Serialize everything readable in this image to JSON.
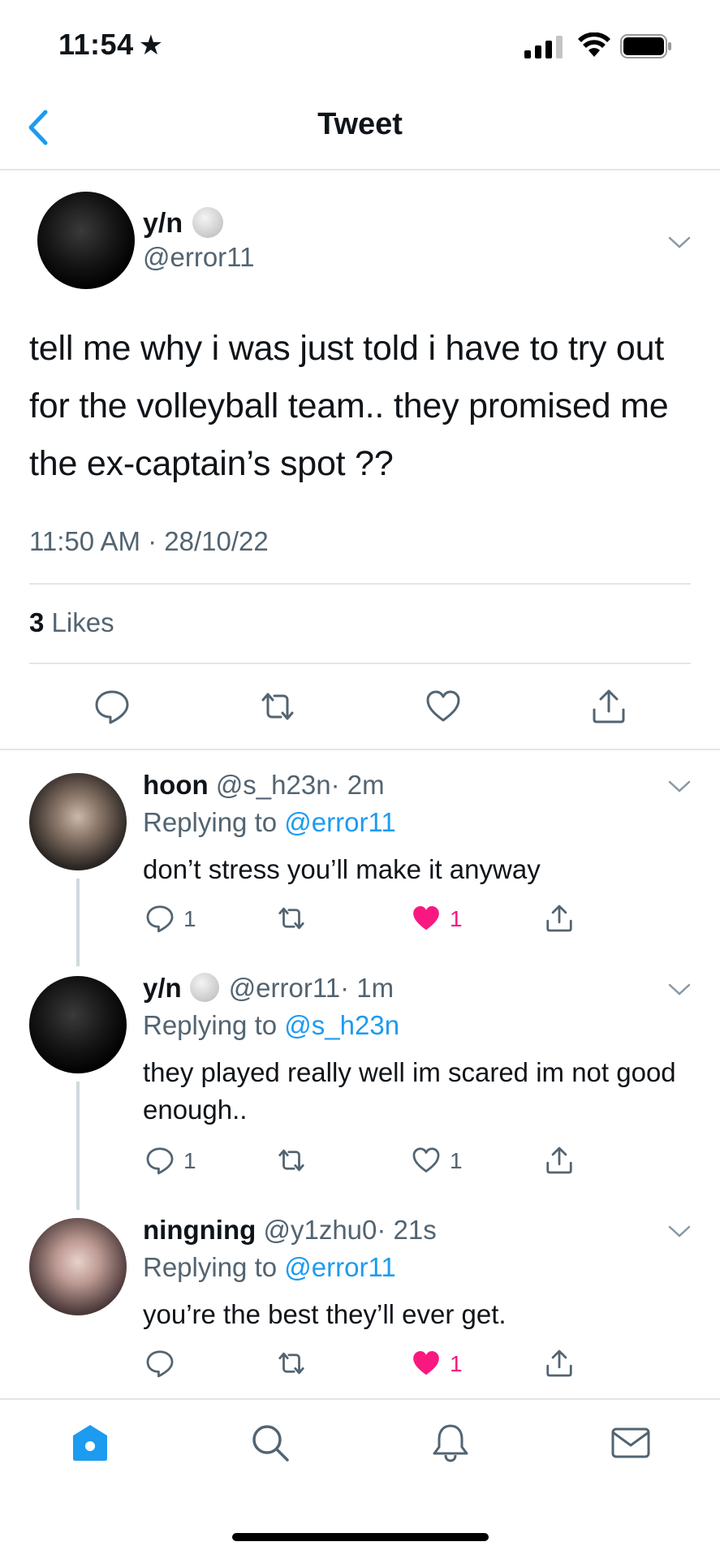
{
  "status_bar": {
    "time": "11:54",
    "time_star": "★"
  },
  "nav": {
    "title": "Tweet"
  },
  "main_tweet": {
    "name": "y/n",
    "handle": "@error11",
    "text": "tell me why i was just told i have to try out for the volleyball team.. they promised me the ex-captain’s spot ??",
    "timestamp": "11:50 AM · 28/10/22",
    "likes_count": "3",
    "likes_label": "Likes"
  },
  "replies": [
    {
      "name": "hoon",
      "handle": "@s_h23n",
      "time": "· 2m",
      "replying_prefix": "Replying to",
      "replying_to": "@error11",
      "text": "don’t stress you’ll make it anyway",
      "reply_count": "1",
      "like_count": "1",
      "liked": true
    },
    {
      "name": "y/n",
      "handle": "@error11",
      "time": "· 1m",
      "replying_prefix": "Replying to",
      "replying_to": "@s_h23n",
      "text": "they played really well im scared im not good enough..",
      "reply_count": "1",
      "like_count": "1",
      "liked": false
    },
    {
      "name": "ningning",
      "handle": "@y1zhu0",
      "time": "· 21s",
      "replying_prefix": "Replying to",
      "replying_to": "@error11",
      "text": "you’re the best they’ll ever get.",
      "reply_count": "",
      "like_count": "1",
      "liked": true
    }
  ],
  "colors": {
    "accent": "#1d9bf0",
    "like": "#f91880",
    "secondary_text": "#536471",
    "divider": "#e1e6ea"
  },
  "icons": {
    "reply": "reply-icon",
    "retweet": "retweet-icon",
    "like": "heart-icon",
    "share": "share-icon",
    "home": "home-icon",
    "search": "search-icon",
    "notifications": "bell-icon",
    "messages": "mail-icon"
  }
}
